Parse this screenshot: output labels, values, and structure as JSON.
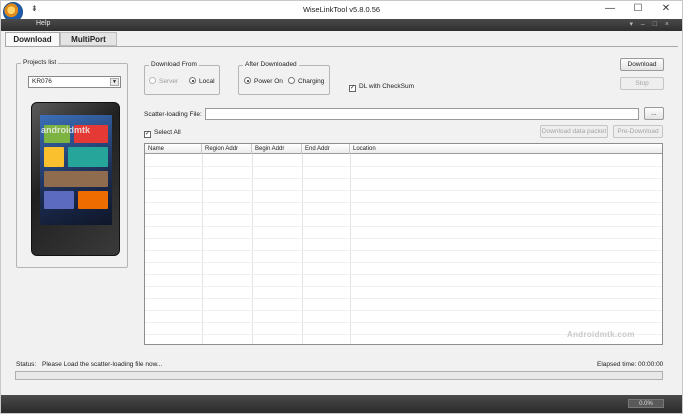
{
  "window": {
    "title": "WiseLinkTool v5.8.0.56",
    "controls": {
      "minimize": "—",
      "maximize": "☐",
      "close": "✕"
    }
  },
  "menu": {
    "help": "Help",
    "right_controls": "▾ – □ ×"
  },
  "tabs": [
    {
      "label": "Download",
      "active": true
    },
    {
      "label": "MultiPort",
      "active": false
    }
  ],
  "projects": {
    "title": "Projects list",
    "selected": "KR076"
  },
  "preview": {
    "watermark": "androidmtk"
  },
  "download_from": {
    "title": "Download From",
    "options": [
      {
        "label": "Server",
        "checked": false,
        "disabled": true
      },
      {
        "label": "Local",
        "checked": true,
        "disabled": false
      }
    ]
  },
  "after_downloaded": {
    "title": "After Downloaded",
    "options": [
      {
        "label": "Power On",
        "checked": true
      },
      {
        "label": "Charging",
        "checked": false
      }
    ]
  },
  "dl_checksum": {
    "label": "DL with CheckSum",
    "checked": true
  },
  "buttons": {
    "download": "Download",
    "stop": "Stop",
    "browse": "...",
    "download_data_packet": "Download data packet",
    "pre_download": "Pre-Download"
  },
  "scatter": {
    "label": "Scatter-loading File:",
    "value": ""
  },
  "select_all": {
    "label": "Select All",
    "checked": true
  },
  "table": {
    "columns": [
      "Name",
      "Region Addr",
      "Begin Addr",
      "End Addr",
      "Location"
    ],
    "rows": []
  },
  "watermark": "Androidmtk.com",
  "status": {
    "label": "Status:",
    "message": "Please Load the scatter-loading file now...",
    "elapsed_label": "Elapsed time:",
    "elapsed_value": "00:00:00"
  },
  "progress": {
    "value": 0,
    "text": "0.0%"
  },
  "colors": {
    "menubar": "#3a3a3a",
    "window_bg": "#f1f1f1",
    "accent": "#1d5fae"
  }
}
